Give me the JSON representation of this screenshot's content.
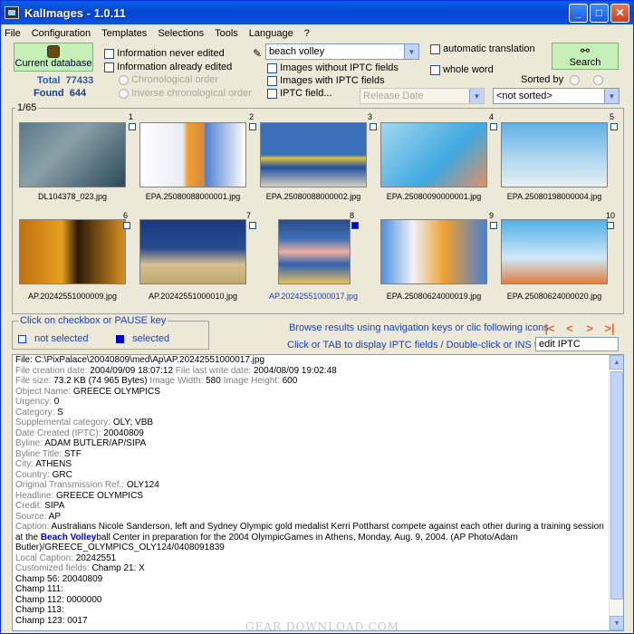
{
  "window": {
    "title": "KalImages - 1.0.11"
  },
  "menu": [
    "File",
    "Configuration",
    "Templates",
    "Selections",
    "Tools",
    "Language",
    "?"
  ],
  "left_panel": {
    "current_db_label": "Current database",
    "total_label": "Total",
    "total_value": "77433",
    "found_label": "Found",
    "found_value": "644"
  },
  "filters": {
    "never_edited": "Information never edited",
    "already_edited": "Information already edited",
    "chrono": "Chronological order",
    "inverse_chrono": "Inverse chronological order",
    "search_value": "beach volley",
    "without_iptc": "Images without IPTC fields",
    "with_iptc": "Images with IPTC fields",
    "iptc_field": "IPTC field...",
    "field_select": "Release Date",
    "auto_translation": "automatic translation",
    "whole_word": "whole word",
    "sorted_by": "Sorted by",
    "sort_select": "<not sorted>",
    "search_button": "Search"
  },
  "gallery": {
    "page": "1/65",
    "items": [
      {
        "num": "1",
        "file": "DL104378_023.jpg",
        "selected": false
      },
      {
        "num": "2",
        "file": "EPA.25080088000001.jpg",
        "selected": false
      },
      {
        "num": "3",
        "file": "EPA.25080088000002.jpg",
        "selected": false
      },
      {
        "num": "4",
        "file": "EPA.25080090000001.jpg",
        "selected": false
      },
      {
        "num": "5",
        "file": "EPA.25080198000004.jpg",
        "selected": false
      },
      {
        "num": "6",
        "file": "AP.20242551000009.jpg",
        "selected": false
      },
      {
        "num": "7",
        "file": "AP.20242551000010.jpg",
        "selected": false
      },
      {
        "num": "8",
        "file": "AP.20242551000017.jpg",
        "selected": true
      },
      {
        "num": "9",
        "file": "EPA.25080624000019.jpg",
        "selected": false
      },
      {
        "num": "10",
        "file": "EPA.25080624000020.jpg",
        "selected": false
      }
    ]
  },
  "legend": {
    "title": "Click on checkbox or PAUSE key",
    "not_selected": "not selected",
    "selected": "selected"
  },
  "nav": {
    "browse_hint": "Browse results using navigation keys or clic following icons",
    "iptc_hint": "Click or TAB to display IPTC fields / Double-click or INS to",
    "edit_iptc": "edit IPTC"
  },
  "details": {
    "file_path": "File: C:\\PixPalace\\20040809\\med\\Ap\\AP.20242551000017.jpg",
    "file_creation_key": "File creation date: ",
    "file_creation_val": "2004/09/09 18:07:12",
    "file_last_write_key": " File last write date: ",
    "file_last_write_val": "2004/08/09 19:02:48",
    "file_size_key": "File size: ",
    "file_size_val": "73.2 KB (74 965 Bytes)",
    "image_width_key": " Image Width: ",
    "image_width_val": "580",
    "image_height_key": " Image Height: ",
    "image_height_val": "600",
    "fields": [
      {
        "k": "Object Name: ",
        "v": "GREECE OLYMPICS"
      },
      {
        "k": "Urgency: ",
        "v": "0"
      },
      {
        "k": "Category: ",
        "v": "S"
      },
      {
        "k": "Supplemental category: ",
        "v": "OLY; VBB"
      },
      {
        "k": "Date Created (IPTC): ",
        "v": "20040809"
      },
      {
        "k": "Byline: ",
        "v": "ADAM BUTLER/AP/SIPA"
      },
      {
        "k": "Byline Title: ",
        "v": "STF"
      },
      {
        "k": "City: ",
        "v": "ATHENS"
      },
      {
        "k": "Country: ",
        "v": "GRC"
      },
      {
        "k": "Original Transmission Ref.: ",
        "v": "OLY124"
      },
      {
        "k": "Headline: ",
        "v": "GREECE OLYMPICS"
      },
      {
        "k": "Credit: ",
        "v": "SIPA"
      },
      {
        "k": "Source: ",
        "v": "AP"
      }
    ],
    "caption_key": "Caption: ",
    "caption_part1": "Australians Nicole Sanderson, left and Sydney Olympic gold medalist Kerri Pottharst compete against each other during a training session at the ",
    "caption_highlight": "Beach Volley",
    "caption_part2": "ball Center in preparation for the  2004 OlympicGames in Athens,  Monday, Aug. 9, 2004.  (AP Photo/Adam Butler)/GREECE_OLYMPICS_OLY124/0408091839",
    "fields2": [
      {
        "k": "Local Caption: ",
        "v": "20242551"
      },
      {
        "k": "Customized fields: ",
        "v": "Champ 21: X"
      },
      {
        "k": "",
        "v": "Champ 56: 20040809"
      },
      {
        "k": "",
        "v": "Champ 111:"
      },
      {
        "k": "",
        "v": "Champ 112: 0000000"
      },
      {
        "k": "",
        "v": "Champ 113:"
      },
      {
        "k": "",
        "v": "Champ 123: 0017"
      }
    ]
  },
  "watermark": "GEAR DOWNLOAD.COM",
  "colors": {
    "title_bar": "#0a5fe8",
    "accent_blue": "#0000cc",
    "nav_orange": "#e07030",
    "search_green": "#c6f0b8"
  }
}
